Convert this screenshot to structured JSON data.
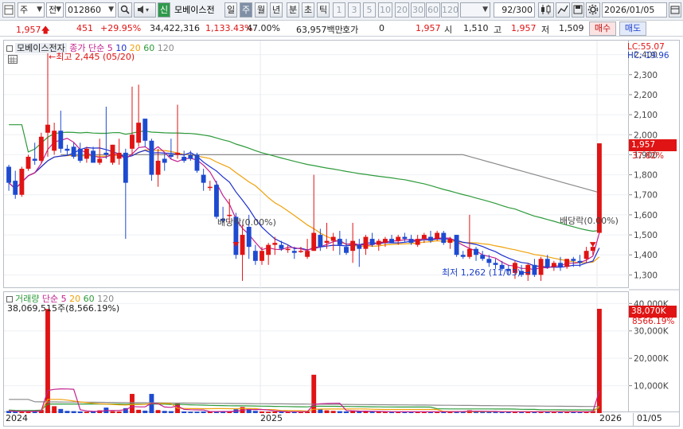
{
  "toolbar": {
    "market": "주",
    "period_type": "전",
    "code": "012860",
    "new_badge": "신",
    "stock_name": "모베이스전",
    "periods": [
      "일",
      "주",
      "월",
      "년",
      "분",
      "초",
      "틱"
    ],
    "active_period": "주",
    "intervals": [
      "1",
      "3",
      "5",
      "10",
      "20",
      "30",
      "60",
      "120"
    ],
    "count": "92",
    "count_total": "/300",
    "date": "2026/01/05"
  },
  "quote": {
    "price": "1,957",
    "change": "451",
    "change_rate": "+29.95%",
    "volume": "34,422,316",
    "volume_rate": "1,133.43%",
    "turnover": "47.00%",
    "amount": "63,957백만",
    "hoga_label": "호가",
    "hoga_value": "0",
    "hoga_price": "1,957",
    "open_label": "시",
    "open": "1,510",
    "high_label": "고",
    "high": "1,957",
    "low_label": "저",
    "low": "1,509",
    "buy_label": "매수",
    "sell_label": "매도"
  },
  "price_legend": {
    "name": "모베이스전자",
    "ma_label": "종가 단순",
    "ma_periods": [
      "5",
      "10",
      "20",
      "60",
      "120"
    ]
  },
  "annotations": {
    "high": "←최고 2,445 (05/20)",
    "low": "최저 1,262 (11/03)",
    "dividend1": "배당락(0.00%)",
    "dividend2": "배당락(0.00%)"
  },
  "volume_legend": {
    "name": "거래량",
    "ma_label": "단순",
    "ma_periods": [
      "5",
      "20",
      "60",
      "120"
    ],
    "current": "38,069,515주(8,566.19%)"
  },
  "price_axis": {
    "lc": "LC:55.07",
    "hc": "HC:-19.96",
    "ticks": [
      "2,400",
      "2,300",
      "2,200",
      "2,100",
      "2,000",
      "1,900",
      "1,800",
      "1,700",
      "1,600",
      "1,500",
      "1,400",
      "1,300"
    ],
    "current_price": "1,957",
    "current_rate": "37.82%"
  },
  "volume_axis": {
    "ticks": [
      "40,000K",
      "30,000K",
      "20,000K",
      "10,000K"
    ],
    "current": "38,070K",
    "current_rate": "8566.19%"
  },
  "date_axis": {
    "labels": [
      "2024",
      "2025",
      "2026",
      "01/05"
    ]
  },
  "colors": {
    "up": "#e01414",
    "down": "#1d4ad0",
    "ma5": "#c2208e",
    "ma10": "#1d2fd0",
    "ma20": "#f0a10a",
    "ma60": "#2d9a3a",
    "ma120": "#8a8a8a"
  },
  "chart_data": {
    "type": "candlestick",
    "y_range": [
      1230,
      2470
    ],
    "candles": [
      [
        1840,
        1850,
        1720,
        1760
      ],
      [
        1770,
        1820,
        1680,
        1700
      ],
      [
        1700,
        1840,
        1690,
        1830
      ],
      [
        1830,
        1900,
        1820,
        1890
      ],
      [
        1880,
        1960,
        1850,
        1870
      ],
      [
        1870,
        2010,
        1860,
        1990
      ],
      [
        2010,
        2445,
        1890,
        2050
      ],
      [
        1920,
        2060,
        1900,
        2020
      ],
      [
        2020,
        2120,
        1910,
        1930
      ],
      [
        1930,
        1950,
        1900,
        1920
      ],
      [
        1940,
        1960,
        1880,
        1890
      ],
      [
        1930,
        1960,
        1860,
        1870
      ],
      [
        1880,
        1940,
        1860,
        1930
      ],
      [
        1920,
        1940,
        1860,
        1860
      ],
      [
        1860,
        1980,
        1850,
        1880
      ],
      [
        1910,
        2140,
        1880,
        1900
      ],
      [
        1860,
        1950,
        1850,
        1950
      ],
      [
        1880,
        1980,
        1850,
        1910
      ],
      [
        1910,
        1930,
        1480,
        1760
      ],
      [
        1930,
        2240,
        1900,
        2000
      ],
      [
        1960,
        2250,
        1940,
        2060
      ],
      [
        2080,
        2080,
        1940,
        1970
      ],
      [
        1970,
        1980,
        1770,
        1800
      ],
      [
        1800,
        1930,
        1740,
        1870
      ],
      [
        1880,
        1910,
        1820,
        1860
      ],
      [
        1900,
        1980,
        1880,
        1890
      ],
      [
        1900,
        2150,
        1880,
        1910
      ],
      [
        1890,
        1920,
        1860,
        1870
      ],
      [
        1900,
        1920,
        1870,
        1880
      ],
      [
        1900,
        1910,
        1810,
        1820
      ],
      [
        1800,
        1830,
        1720,
        1760
      ],
      [
        1740,
        1770,
        1720,
        1740
      ],
      [
        1750,
        1770,
        1580,
        1590
      ],
      [
        1580,
        1640,
        1560,
        1570
      ],
      [
        1600,
        1680,
        1560,
        1600
      ],
      [
        1590,
        1610,
        1380,
        1400
      ],
      [
        1400,
        1550,
        1270,
        1500
      ],
      [
        1540,
        1600,
        1380,
        1440
      ],
      [
        1420,
        1450,
        1350,
        1370
      ],
      [
        1370,
        1440,
        1350,
        1420
      ],
      [
        1400,
        1460,
        1350,
        1450
      ],
      [
        1450,
        1490,
        1400,
        1460
      ],
      [
        1450,
        1470,
        1420,
        1430
      ],
      [
        1430,
        1450,
        1410,
        1430
      ],
      [
        1420,
        1440,
        1380,
        1410
      ],
      [
        1420,
        1440,
        1410,
        1420
      ],
      [
        1390,
        1480,
        1380,
        1420
      ],
      [
        1420,
        1800,
        1420,
        1510
      ],
      [
        1500,
        1530,
        1420,
        1440
      ],
      [
        1460,
        1560,
        1430,
        1470
      ],
      [
        1470,
        1510,
        1420,
        1490
      ],
      [
        1480,
        1520,
        1400,
        1450
      ],
      [
        1440,
        1480,
        1400,
        1410
      ],
      [
        1420,
        1560,
        1360,
        1470
      ],
      [
        1450,
        1480,
        1340,
        1430
      ],
      [
        1430,
        1500,
        1400,
        1490
      ],
      [
        1480,
        1510,
        1440,
        1450
      ],
      [
        1450,
        1480,
        1420,
        1470
      ],
      [
        1460,
        1490,
        1440,
        1480
      ],
      [
        1480,
        1500,
        1460,
        1460
      ],
      [
        1470,
        1500,
        1450,
        1490
      ],
      [
        1490,
        1510,
        1460,
        1480
      ],
      [
        1480,
        1500,
        1450,
        1460
      ],
      [
        1450,
        1500,
        1440,
        1480
      ],
      [
        1480,
        1510,
        1460,
        1500
      ],
      [
        1490,
        1520,
        1460,
        1470
      ],
      [
        1480,
        1520,
        1470,
        1510
      ],
      [
        1510,
        1520,
        1450,
        1460
      ],
      [
        1460,
        1490,
        1430,
        1480
      ],
      [
        1500,
        1500,
        1390,
        1400
      ],
      [
        1400,
        1420,
        1380,
        1390
      ],
      [
        1390,
        1600,
        1380,
        1430
      ],
      [
        1430,
        1440,
        1370,
        1400
      ],
      [
        1400,
        1420,
        1370,
        1380
      ],
      [
        1380,
        1400,
        1340,
        1360
      ],
      [
        1360,
        1380,
        1330,
        1350
      ],
      [
        1350,
        1370,
        1320,
        1330
      ],
      [
        1330,
        1350,
        1300,
        1320
      ],
      [
        1310,
        1370,
        1280,
        1360
      ],
      [
        1320,
        1350,
        1290,
        1300
      ],
      [
        1300,
        1360,
        1270,
        1350
      ],
      [
        1350,
        1380,
        1290,
        1300
      ],
      [
        1300,
        1390,
        1270,
        1380
      ],
      [
        1380,
        1400,
        1330,
        1340
      ],
      [
        1340,
        1370,
        1320,
        1360
      ],
      [
        1360,
        1390,
        1320,
        1340
      ],
      [
        1340,
        1380,
        1330,
        1380
      ],
      [
        1380,
        1390,
        1340,
        1370
      ],
      [
        1370,
        1400,
        1340,
        1360
      ],
      [
        1380,
        1440,
        1360,
        1420
      ],
      [
        1420,
        1460,
        1400,
        1440
      ],
      [
        1510,
        1957,
        1509,
        1957
      ]
    ],
    "volume": [
      0.8,
      0.6,
      0.5,
      0.7,
      0.9,
      1.2,
      38.0,
      2.5,
      1.5,
      0.8,
      0.7,
      0.6,
      0.5,
      0.6,
      1.0,
      2.0,
      0.7,
      0.6,
      1.8,
      7.0,
      1.2,
      0.9,
      7.0,
      1.1,
      0.8,
      0.7,
      3.5,
      0.6,
      0.5,
      0.5,
      0.6,
      0.5,
      0.7,
      0.6,
      0.5,
      1.4,
      2.2,
      1.5,
      0.8,
      0.6,
      0.5,
      0.6,
      0.5,
      0.4,
      0.5,
      0.4,
      0.6,
      14.0,
      1.5,
      1.0,
      0.8,
      0.7,
      0.6,
      0.9,
      0.7,
      0.6,
      0.5,
      0.5,
      0.4,
      0.5,
      0.4,
      0.5,
      0.5,
      0.4,
      0.5,
      0.4,
      0.5,
      0.5,
      0.6,
      0.7,
      0.6,
      1.0,
      0.6,
      0.5,
      0.5,
      0.5,
      0.4,
      0.5,
      0.6,
      0.5,
      0.5,
      0.4,
      0.6,
      0.5,
      0.4,
      0.5,
      0.4,
      0.5,
      0.4,
      0.6,
      0.8,
      38.07
    ],
    "volume_range": [
      0,
      43
    ]
  }
}
